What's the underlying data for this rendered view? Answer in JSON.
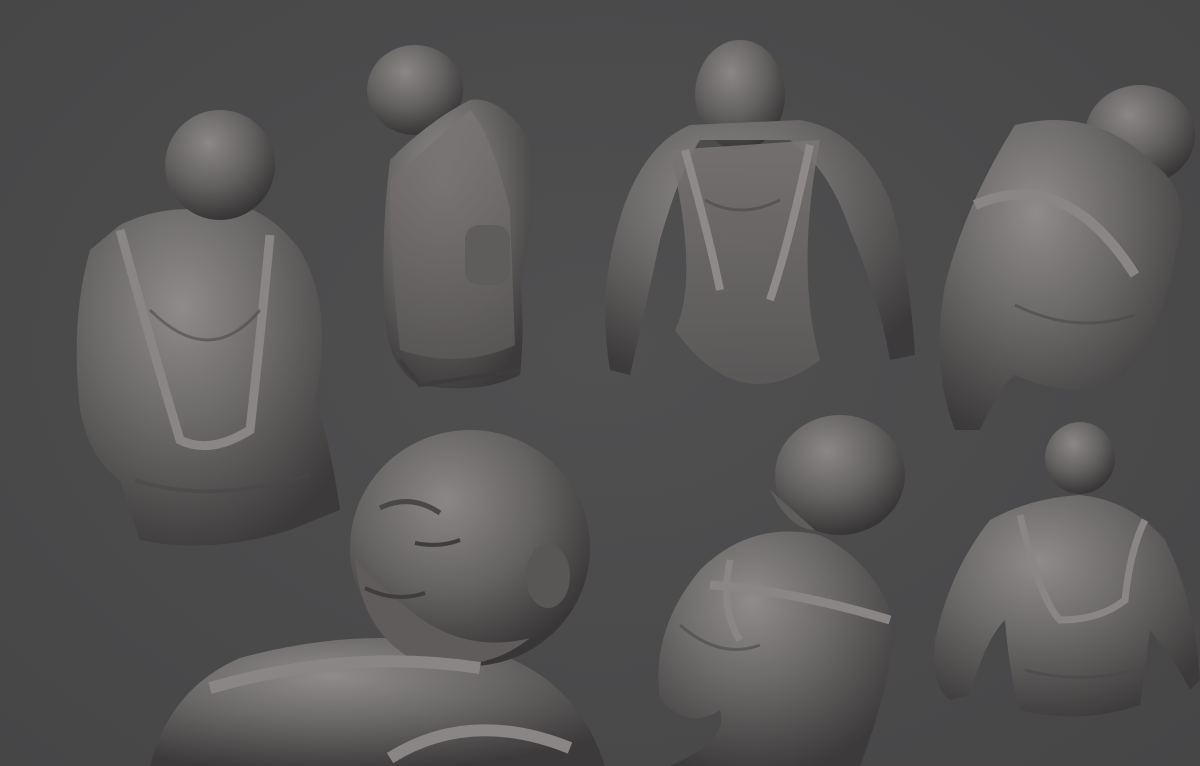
{
  "scene": {
    "description_visible_text": "",
    "background_color": "#4a4a4b",
    "clay_color": "#6e6b6b",
    "clay_shadow": "#3a3838",
    "clay_highlight": "#8d8a89"
  },
  "sculpts": [
    {
      "id": "back-view-left",
      "icon": "figure-back-icon"
    },
    {
      "id": "three-quarter-tilted",
      "icon": "figure-side-icon"
    },
    {
      "id": "front-view",
      "icon": "figure-front-icon"
    },
    {
      "id": "top-back-view",
      "icon": "figure-top-icon"
    },
    {
      "id": "face-closeup",
      "icon": "figure-face-icon"
    },
    {
      "id": "side-profile",
      "icon": "figure-profile-icon"
    },
    {
      "id": "back-view-right",
      "icon": "figure-back-icon"
    }
  ]
}
